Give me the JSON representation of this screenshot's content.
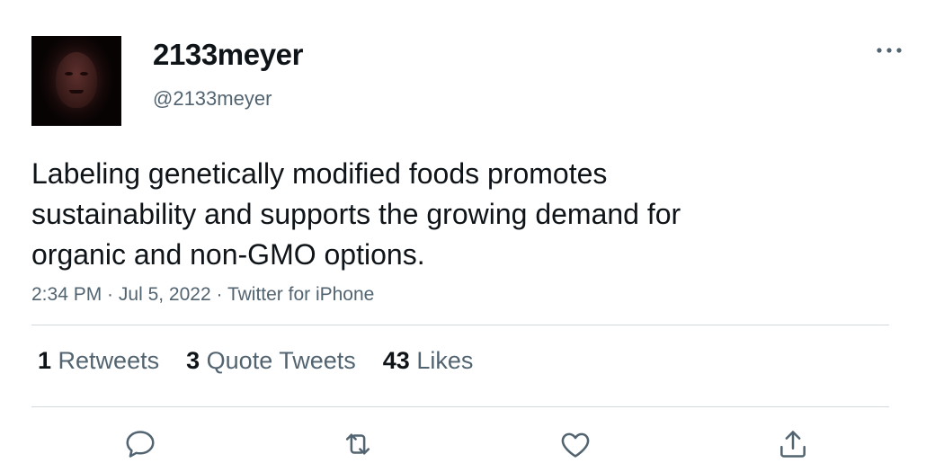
{
  "user": {
    "display_name": "2133meyer",
    "handle": "@2133meyer",
    "avatar_icon": "profile-photo"
  },
  "tweet": {
    "text": "Labeling genetically modified foods promotes\nsustainability and supports the growing demand for\norganic and non-GMO options.",
    "time": "2:34 PM",
    "date": "Jul 5, 2022",
    "source": "Twitter for iPhone",
    "separator": " · "
  },
  "stats": {
    "retweets_count": "1",
    "retweets_label": "Retweets",
    "quote_count": "3",
    "quote_label": "Quote Tweets",
    "likes_count": "43",
    "likes_label": "Likes"
  },
  "actions": {
    "reply_icon": "reply-icon",
    "retweet_icon": "retweet-icon",
    "like_icon": "like-icon",
    "share_icon": "share-icon",
    "more_icon": "more-icon"
  },
  "colors": {
    "text_primary": "#0f1419",
    "text_secondary": "#536471",
    "divider": "#cfd9de"
  }
}
